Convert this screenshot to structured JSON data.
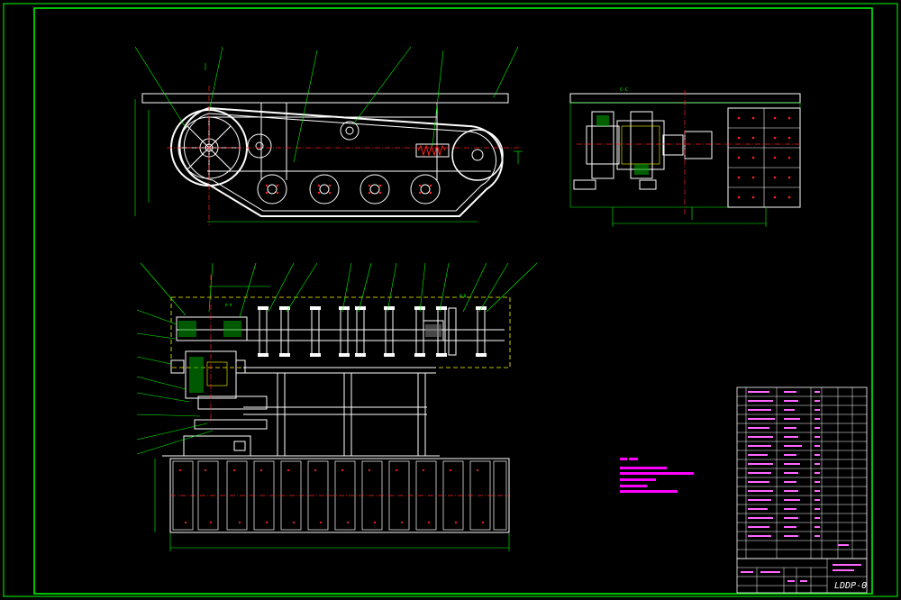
{
  "colors": {
    "background": "#000000",
    "frame": "#00ff00",
    "part": "#ffffff",
    "centerline": "#ff2020",
    "hidden": "#ffff00",
    "leader": "#00ff00",
    "dimension": "#00ff00",
    "note": "#ff00ff",
    "table_text": "#ff66ff",
    "section": "#ff4040"
  },
  "views": {
    "side": {
      "section_label": ""
    },
    "end": {
      "section_label": "C-C"
    },
    "plan": {
      "section_label": "A-A",
      "section_label_2": "B-B"
    }
  },
  "title_block": {
    "drawing_code": "LDDP-0"
  },
  "icons": {
    "sprocket": "circle-spokes",
    "roller": "circle",
    "track": "hatched-plate"
  }
}
